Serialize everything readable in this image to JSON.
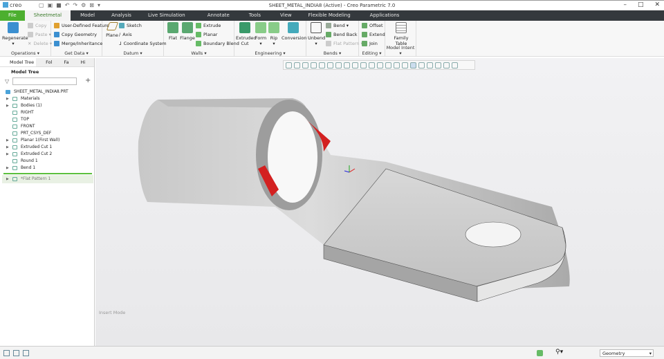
{
  "app": {
    "logo": "creo",
    "title": "SHEET_METAL_INDIA8 (Active) - Creo Parametric 7.0"
  },
  "tabs": [
    "File",
    "Sheetmetal",
    "Model",
    "Analysis",
    "Live Simulation",
    "Annotate",
    "Tools",
    "View",
    "Flexible Modeling",
    "Applications"
  ],
  "ribbon": {
    "operations": {
      "label": "Operations ▾",
      "regenerate": "Regenerate",
      "copy": "Copy",
      "paste": "Paste ▾",
      "delete": "Delete ▾"
    },
    "getdata": {
      "label": "Get Data ▾",
      "udf": "User-Defined Feature",
      "copygeom": "Copy Geometry",
      "merge": "Merge/Inheritance"
    },
    "datum": {
      "label": "Datum ▾",
      "plane": "Plane",
      "sketch": "Sketch",
      "axis": "Axis",
      "csys": "Coordinate System"
    },
    "walls": {
      "label": "Walls ▾",
      "flat": "Flat",
      "flange": "Flange",
      "extrude": "Extrude",
      "planar": "Planar",
      "blend": "Boundary Blend"
    },
    "engineering": {
      "label": "Engineering ▾",
      "extcut": "Extruded Cut",
      "form": "Form",
      "rip": "Rip",
      "conversion": "Conversion"
    },
    "bends": {
      "label": "Bends ▾",
      "unbend": "Unbend",
      "bend": "Bend ▾",
      "bendback": "Bend Back",
      "flatpattern": "Flat Pattern ▾"
    },
    "editing": {
      "label": "Editing ▾",
      "offset": "Offset",
      "extend": "Extend",
      "join": "Join"
    },
    "intent": {
      "label": "Model Intent ▾",
      "family": "Family Table"
    }
  },
  "left": {
    "tabs": [
      "Model Tree",
      "Fol",
      "Fa",
      "Hi"
    ],
    "header": "Model Tree",
    "search_placeholder": "",
    "root": "SHEET_METAL_INDIA8.PRT",
    "items": [
      "Materials",
      "Bodies (1)",
      "RIGHT",
      "TOP",
      "FRONT",
      "PRT_CSYS_DEF",
      "Planar 1(First Wall)",
      "Extruded Cut 1",
      "Extruded Cut 2",
      "Round 1",
      "Bend 1"
    ],
    "after": "*Flat Pattern 1"
  },
  "graphics": {
    "mode": "Insert Mode"
  },
  "status": {
    "filter": "Geometry"
  }
}
